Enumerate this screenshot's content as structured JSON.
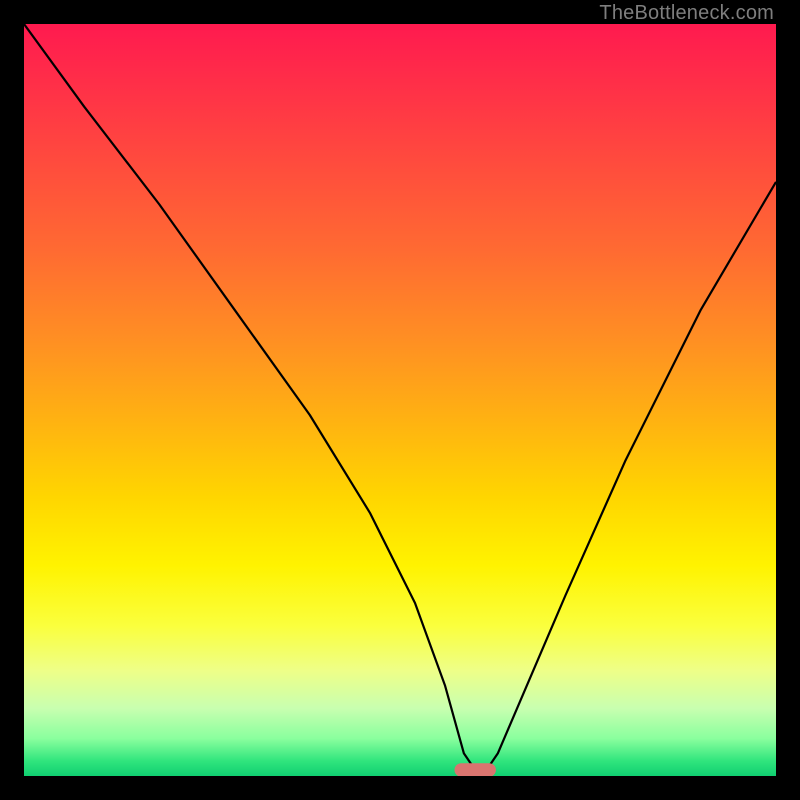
{
  "watermark": "TheBottleneck.com",
  "chart_data": {
    "type": "line",
    "title": "",
    "xlabel": "",
    "ylabel": "",
    "xlim": [
      0,
      100
    ],
    "ylim": [
      0,
      100
    ],
    "grid": false,
    "legend": false,
    "series": [
      {
        "name": "bottleneck-curve",
        "x": [
          0,
          8,
          18,
          28,
          38,
          46,
          52,
          56,
          58.5,
          60,
          61.5,
          63,
          66,
          72,
          80,
          90,
          100
        ],
        "values": [
          100,
          89,
          76,
          62,
          48,
          35,
          23,
          12,
          3,
          0.8,
          0.8,
          3,
          10,
          24,
          42,
          62,
          79
        ]
      }
    ],
    "annotations": [
      {
        "name": "optimal-marker",
        "shape": "pill",
        "x_center": 60,
        "y_center": 0.8,
        "width": 5.5,
        "height": 1.8,
        "color": "#d9746f"
      }
    ],
    "background_gradient": {
      "orientation": "vertical",
      "stops": [
        {
          "pos": 0,
          "color": "#ff1a4f"
        },
        {
          "pos": 30,
          "color": "#ff6a32"
        },
        {
          "pos": 63,
          "color": "#ffd600"
        },
        {
          "pos": 86,
          "color": "#eeff88"
        },
        {
          "pos": 100,
          "color": "#10cf71"
        }
      ]
    }
  }
}
